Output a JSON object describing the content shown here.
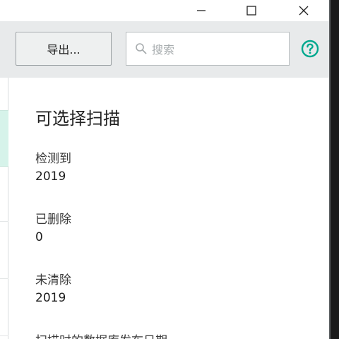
{
  "window": {
    "controls": {
      "minimize_icon": "minimize-icon",
      "maximize_icon": "maximize-icon",
      "close_icon": "close-icon"
    }
  },
  "toolbar": {
    "export_label": "导出...",
    "search": {
      "placeholder": "搜索",
      "icon": "search-icon"
    },
    "help_icon": "help-icon",
    "accent_color": "#00a88e"
  },
  "details": {
    "title": "可选择扫描",
    "fields": [
      {
        "label": "检测到",
        "value": "2019"
      },
      {
        "label": "已删除",
        "value": "0"
      },
      {
        "label": "未清除",
        "value": "2019"
      },
      {
        "label": "扫描时的数据库发布日期",
        "value": ""
      }
    ]
  }
}
